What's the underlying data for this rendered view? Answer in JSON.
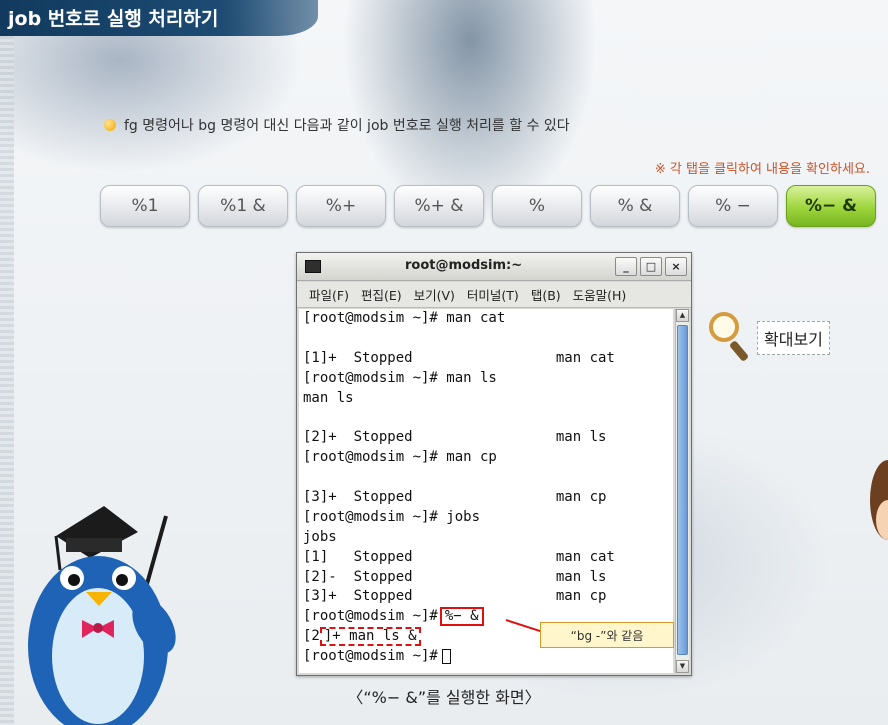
{
  "header": {
    "title": "job 번호로 실행 처리하기"
  },
  "intro": {
    "text": "fg 명령어나 bg 명령어 대신 다음과 같이 job 번호로 실행 처리를 할 수 있다"
  },
  "hint": "※ 각 탭을 클릭하여 내용을 확인하세요.",
  "tabs": [
    {
      "label": "%1",
      "active": false
    },
    {
      "label": "%1 &",
      "active": false
    },
    {
      "label": "%+",
      "active": false
    },
    {
      "label": "%+ &",
      "active": false
    },
    {
      "label": "%",
      "active": false
    },
    {
      "label": "% &",
      "active": false
    },
    {
      "label": "% −",
      "active": false
    },
    {
      "label": "%− &",
      "active": true
    }
  ],
  "terminal": {
    "title": "root@modsim:~",
    "buttons": {
      "minimize": "_",
      "maximize": "□",
      "close": "×"
    },
    "menu": [
      "파일(F)",
      "편집(E)",
      "보기(V)",
      "터미널(T)",
      "탭(B)",
      "도움말(H)"
    ],
    "lines": [
      "[root@modsim ~]# man cat",
      "",
      "[1]+  Stopped                 man cat",
      "[root@modsim ~]# man ls",
      "man ls",
      "",
      "[2]+  Stopped                 man ls",
      "[root@modsim ~]# man cp",
      "",
      "[3]+  Stopped                 man cp",
      "[root@modsim ~]# jobs",
      "jobs",
      "[1]   Stopped                 man cat",
      "[2]-  Stopped                 man ls",
      "[3]+  Stopped                 man cp"
    ],
    "prompt": "[root@modsim ~]#",
    "highlighted_cmd": "%− &",
    "result_prefix": "[2",
    "result_highlight": "]+ man ls &",
    "last_prompt": "[root@modsim ~]#"
  },
  "callout": "“bg -”와 같음",
  "zoom_label": "확대보기",
  "caption": "〈“%− &”를 실행한 화면〉",
  "colors": {
    "title_bg": "#1d4b73",
    "active_tab": "#9dd53c",
    "highlight": "#e01010"
  },
  "icons": {
    "zoom": "magnifier-icon",
    "bullet": "bullet-dot-icon"
  }
}
